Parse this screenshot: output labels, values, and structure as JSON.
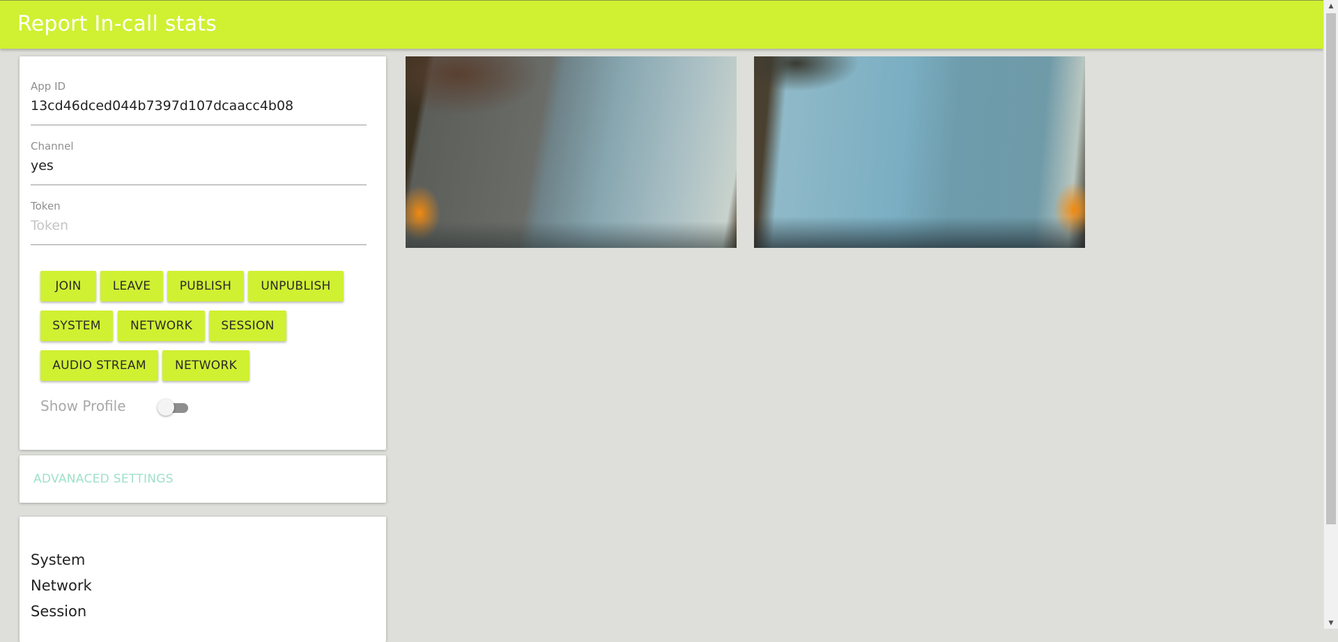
{
  "header": {
    "title": "Report In-call stats"
  },
  "form": {
    "app_id": {
      "label": "App ID",
      "value": "13cd46dced044b7397d107dcaacc4b08"
    },
    "channel": {
      "label": "Channel",
      "value": "yes"
    },
    "token": {
      "label": "Token",
      "value": "",
      "placeholder": "Token"
    }
  },
  "buttons": {
    "row1": [
      "JOIN",
      "LEAVE",
      "PUBLISH",
      "UNPUBLISH"
    ],
    "row2": [
      "SYSTEM",
      "NETWORK",
      "SESSION"
    ],
    "row3": [
      "AUDIO STREAM",
      "NETWORK"
    ]
  },
  "show_profile": {
    "label": "Show Profile",
    "checked": false
  },
  "advanced": {
    "label": "ADVANACED SETTINGS"
  },
  "stats": {
    "items": [
      "System",
      "Network",
      "Session"
    ]
  },
  "colors": {
    "accent": "#d0f032",
    "background": "#dedfda",
    "advanced_text": "#9fe0c8"
  }
}
